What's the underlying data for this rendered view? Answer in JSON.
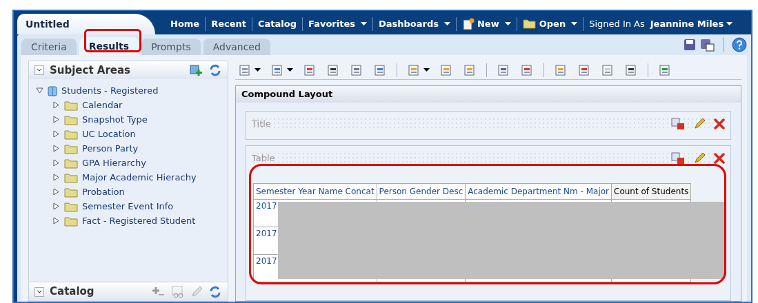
{
  "header": {
    "document_title": "Untitled",
    "nav": [
      {
        "label": "Home",
        "kind": "link",
        "menu": false
      },
      {
        "label": "Recent",
        "kind": "link",
        "menu": false
      },
      {
        "label": "Catalog",
        "kind": "link",
        "menu": false
      },
      {
        "label": "Favorites",
        "kind": "link",
        "menu": true
      },
      {
        "label": "Dashboards",
        "kind": "link",
        "menu": true
      },
      {
        "label": "New",
        "kind": "new",
        "menu": true
      },
      {
        "label": "Open",
        "kind": "open",
        "menu": true
      }
    ],
    "signed_in_label": "Signed In As",
    "user": "Jeannine Miles"
  },
  "tabs": [
    {
      "label": "Criteria",
      "selected": false
    },
    {
      "label": "Results",
      "selected": true
    },
    {
      "label": "Prompts",
      "selected": false
    },
    {
      "label": "Advanced",
      "selected": false
    }
  ],
  "subject_areas": {
    "title": "Subject Areas",
    "tree": {
      "label": "Students - Registered",
      "expanded": true,
      "children": [
        {
          "label": "Calendar",
          "expanded": false
        },
        {
          "label": "Snapshot Type",
          "expanded": false
        },
        {
          "label": "UC Location",
          "expanded": false
        },
        {
          "label": "Person Party",
          "expanded": false
        },
        {
          "label": "GPA Hierarchy",
          "expanded": false
        },
        {
          "label": "Major Academic Hierachy",
          "expanded": false
        },
        {
          "label": "Probation",
          "expanded": false
        },
        {
          "label": "Semester Event Info",
          "expanded": false
        },
        {
          "label": "Fact - Registered Student",
          "expanded": false
        }
      ]
    }
  },
  "catalog": {
    "title": "Catalog"
  },
  "layout": {
    "title": "Compound Layout",
    "views": [
      {
        "label": "Title"
      },
      {
        "label": "Table"
      }
    ]
  },
  "table": {
    "columns": [
      "Semester Year Name Concat",
      "Person Gender Desc",
      "Academic Department Nm - Major",
      "Count of Students"
    ],
    "rows": [
      {
        "column_1": "2017"
      },
      {
        "column_1": "2017"
      },
      {
        "column_1": "2017"
      }
    ]
  }
}
